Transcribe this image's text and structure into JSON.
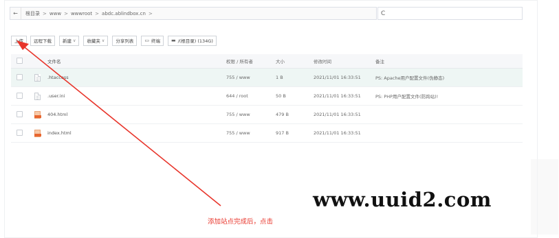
{
  "pathbar": {
    "back_icon": "←",
    "crumbs": [
      "根目录",
      "www",
      "wwwroot",
      "abdc.ablindbox.cn"
    ],
    "separator": ">",
    "refresh_icon": "C"
  },
  "toolbar": {
    "upload": "上传",
    "remote_download": "远程下载",
    "new": "新建",
    "favorites": "收藏夹",
    "share_list": "分享列表",
    "terminal": "终端",
    "disk": "/(根目录) (134G)",
    "caret": "∨"
  },
  "table": {
    "headers": {
      "name": "文件名",
      "perm": "权限 / 所有者",
      "size": "大小",
      "time": "修改时间",
      "note": "备注"
    },
    "rows": [
      {
        "name": ".htaccess",
        "perm": "755 / www",
        "size": "1 B",
        "time": "2021/11/01 16:33:51",
        "note": "PS: Apache用户配置文件(伪静态)",
        "type": "file"
      },
      {
        "name": ".user.ini",
        "perm": "644 / root",
        "size": "50 B",
        "time": "2021/11/01 16:33:51",
        "note": "PS: PHP用户配置文件(防跨站)!",
        "type": "file"
      },
      {
        "name": "404.html",
        "perm": "755 / www",
        "size": "479 B",
        "time": "2021/11/01 16:33:51",
        "note": "",
        "type": "html"
      },
      {
        "name": "index.html",
        "perm": "755 / www",
        "size": "917 B",
        "time": "2021/11/01 16:33:51",
        "note": "",
        "type": "html"
      }
    ]
  },
  "annotation": {
    "hint_text": "添加站点完成后，点击",
    "arrow_color": "#e8352b"
  },
  "watermark": "www.uuid2.com"
}
